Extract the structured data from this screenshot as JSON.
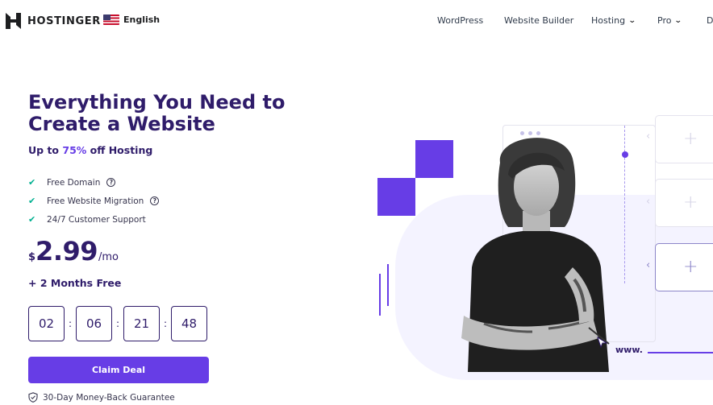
{
  "header": {
    "brand": "HOSTINGER",
    "language": "English",
    "nav": [
      {
        "label": "WordPress"
      },
      {
        "label": "Website Builder"
      },
      {
        "label": "Hosting",
        "dropdown": true
      },
      {
        "label": "Pro",
        "dropdown": true
      },
      {
        "label": "D"
      }
    ]
  },
  "hero": {
    "title": "Everything You Need to Create a Website",
    "subtitle_prefix": "Up to ",
    "subtitle_accent": "75%",
    "subtitle_suffix": " off Hosting",
    "features": [
      {
        "label": "Free Domain",
        "help": true
      },
      {
        "label": "Free Website Migration",
        "help": true
      },
      {
        "label": "24/7 Customer Support",
        "help": false
      }
    ],
    "price": {
      "currency": "$",
      "amount": "2.99",
      "period": "/mo"
    },
    "bonus": "+ 2 Months Free",
    "timer": [
      "02",
      "06",
      "21",
      "48"
    ],
    "timer_separator": ":",
    "cta": "Claim Deal",
    "guarantee": "30-Day Money-Back Guarantee"
  },
  "illustration": {
    "url_text": "www."
  },
  "colors": {
    "primary": "#673de6",
    "heading": "#2f1c6a",
    "check": "#00b090",
    "blob": "#f4f3ff"
  }
}
